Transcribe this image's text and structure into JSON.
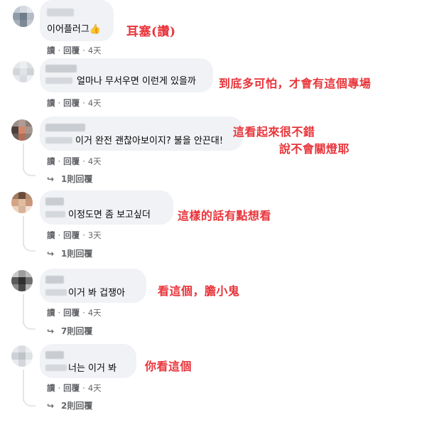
{
  "colors": {
    "bubble": "#f0f2f5",
    "action_text": "#65676b",
    "annotation": "#e8343a"
  },
  "comments": [
    {
      "text": "이어플러그",
      "emoji": "👍",
      "reply_label": "讀",
      "reply_action": "回覆",
      "time": "4天",
      "annotation": "耳塞(讚)"
    },
    {
      "text": "얼마나 무서우면 이런게 있을까",
      "reply_label": "讀",
      "reply_action": "回覆",
      "time": "4天",
      "annotation": "到底多可怕，才會有這個專場"
    },
    {
      "text": "이거 완전 괜찮아보이지? 불을 안끈대!",
      "reply_label": "讀",
      "reply_action": "回覆",
      "time": "4天",
      "replies": "1則回覆",
      "annotation_line1": "這看起來很不錯",
      "annotation_line2": "說不會關燈耶"
    },
    {
      "text": "이정도면 좀 보고싶더",
      "reply_label": "讀",
      "reply_action": "回覆",
      "time": "3天",
      "replies": "1則回覆",
      "annotation": "這樣的話有點想看"
    },
    {
      "text": "이거 봐 겁쟁아",
      "reply_label": "讀",
      "reply_action": "回覆",
      "time": "4天",
      "replies": "7則回覆",
      "annotation": "看這個，膽小鬼"
    },
    {
      "text": "너는 이거 봐",
      "reply_label": "讀",
      "reply_action": "回覆",
      "time": "4天",
      "replies": "2則回覆",
      "annotation": "你看這個"
    }
  ]
}
